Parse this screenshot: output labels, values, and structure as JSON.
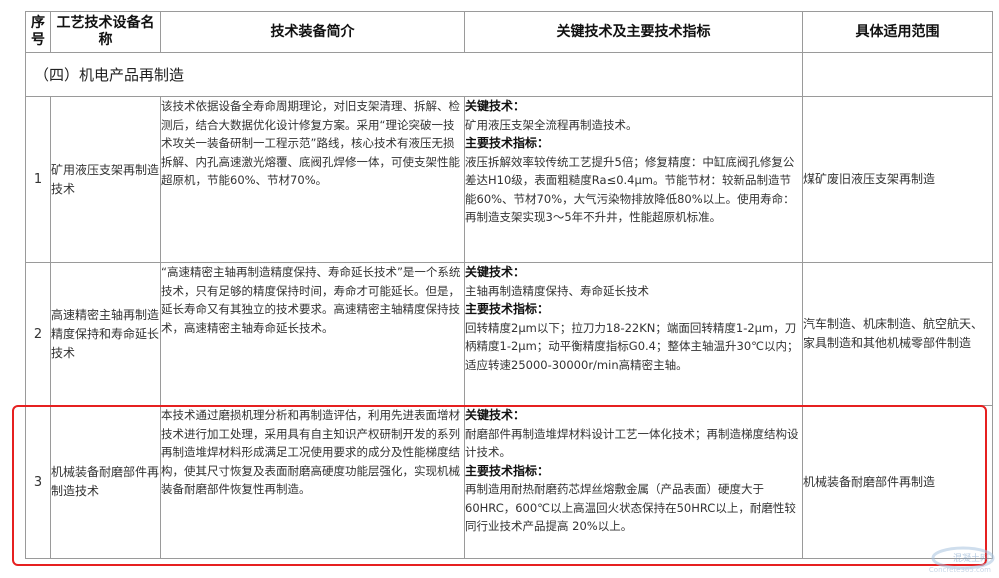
{
  "header": {
    "col_no": "序号",
    "col_name": "工艺技术设备名称",
    "col_intro": "技术装备简介",
    "col_key": "关键技术及主要技术指标",
    "col_scope": "具体适用范围"
  },
  "section_title": "（四）机电产品再制造",
  "rows": [
    {
      "no": "1",
      "name": "矿用液压支架再制造技术",
      "intro": "该技术依据设备全寿命周期理论，对旧支架清理、拆解、检测后，结合大数据优化设计修复方案。采用“理论突破一技术攻关一装备研制一工程示范”路线，核心技术有液压无损拆解、内孔高速激光熔覆、底阀孔焊修一体，可使支架性能超原机，节能60%、节材70%。",
      "key_label": "关键技术：",
      "key_text": "矿用液压支架全流程再制造技术。",
      "main_label": "主要技术指标：",
      "main_text": "液压拆解效率较传统工艺提升5倍；修复精度：中缸底阀孔修复公差达H10级，表面粗糙度Ra≤0.4μm。节能节材：较新品制造节能60%、节材70%，大气污染物排放降低80%以上。使用寿命：再制造支架实现3～5年不升井，性能超原机标准。",
      "scope": "煤矿废旧液压支架再制造"
    },
    {
      "no": "2",
      "name": "高速精密主轴再制造精度保持和寿命延长技术",
      "intro": "“高速精密主轴再制造精度保持、寿命延长技术”是一个系统技术，只有足够的精度保持时间，寿命才可能延长。但是，延长寿命又有其独立的技术要求。高速精密主轴精度保持技术，高速精密主轴寿命延长技术。",
      "key_label": "关键技术：",
      "key_text": "主轴再制造精度保持、寿命延长技术",
      "main_label": "主要技术指标：",
      "main_text": "回转精度2μm以下；拉刀力18-22KN；端面回转精度1-2μm，刀柄精度1-2μm；动平衡精度指标G0.4；整体主轴温升30℃以内；适应转速25000-30000r/min高精密主轴。",
      "scope": "汽车制造、机床制造、航空航天、家具制造和其他机械零部件制造"
    },
    {
      "no": "3",
      "name": "机械装备耐磨部件再制造技术",
      "intro": "本技术通过磨损机理分析和再制造评估，利用先进表面增材技术进行加工处理，采用具有自主知识产权研制开发的系列再制造堆焊材料形成满足工况使用要求的成分及性能梯度结构，使其尺寸恢复及表面耐磨高硬度功能层强化，实现机械装备耐磨部件恢复性再制造。",
      "key_label": "关键技术：",
      "key_text": "耐磨部件再制造堆焊材料设计工艺一体化技术；再制造梯度结构设计技术。",
      "main_label": "主要技术指标：",
      "main_text": "再制造用耐热耐磨药芯焊丝熔敷金属（产品表面）硬度大于 60HRC，600℃以上高温回火状态保持在50HRC以上，耐磨性较同行业技术产品提高 20%以上。",
      "scope": "机械装备耐磨部件再制造"
    }
  ],
  "watermark": {
    "text": "混凝土网",
    "sub": "Concrete365.com"
  },
  "colors": {
    "highlight": "#e62020",
    "grid": "#9a9a9a"
  }
}
